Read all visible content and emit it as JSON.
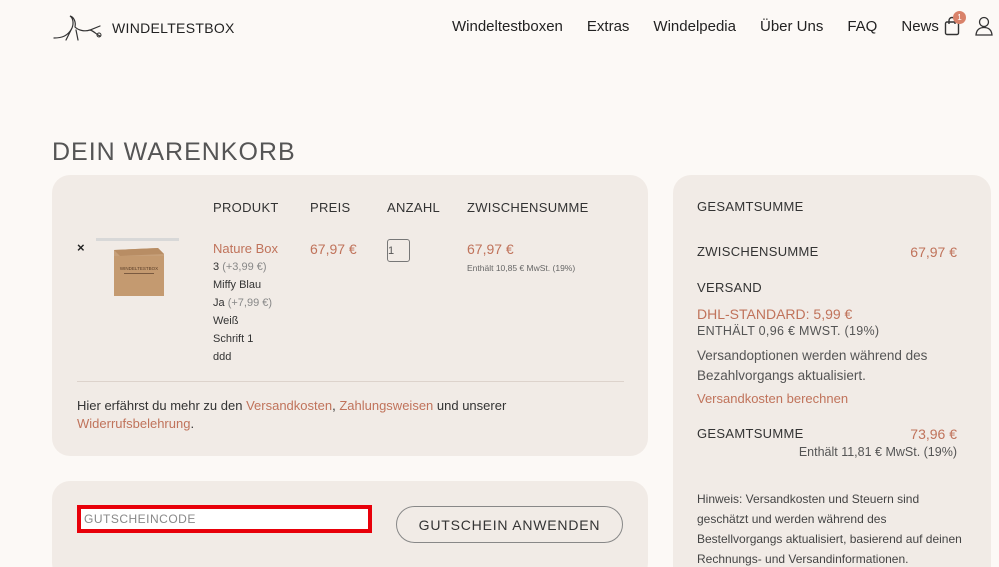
{
  "header": {
    "logo_text": "WINDELTESTBOX",
    "nav": [
      "Windeltestboxen",
      "Extras",
      "Windelpedia",
      "Über Uns",
      "FAQ",
      "News"
    ],
    "cart_count": "1"
  },
  "page_title": "DEIN WARENKORB",
  "cart": {
    "columns": {
      "product": "PRODUKT",
      "price": "PREIS",
      "quantity": "ANZAHL",
      "subtotal": "ZWISCHENSUMME"
    },
    "remove_label": "×",
    "item": {
      "image_text": "WINDELTESTBOX",
      "name": "Nature Box",
      "meta": [
        {
          "text": "3",
          "extra": "(+3,99 €)"
        },
        {
          "text": "Miffy Blau",
          "extra": ""
        },
        {
          "text": "Ja",
          "extra": "(+7,99 €)"
        },
        {
          "text": "Weiß",
          "extra": ""
        },
        {
          "text": "Schrift 1",
          "extra": ""
        },
        {
          "text": "ddd",
          "extra": ""
        }
      ],
      "price": "67,97 €",
      "quantity": "1",
      "subtotal": "67,97 €",
      "tax_note": "Enthält 10,85 € MwSt. (19%)"
    },
    "info": {
      "prefix": "Hier erfährst du mehr zu den ",
      "link1": "Versandkosten",
      "sep": ", ",
      "link2": "Zahlungsweisen",
      "mid": " und unserer ",
      "link3": "Widerrufsbelehrung",
      "suffix": "."
    }
  },
  "coupon": {
    "placeholder": "GUTSCHEINCODE",
    "button": "GUTSCHEIN ANWENDEN"
  },
  "totals": {
    "heading": "GESAMTSUMME",
    "subtotal_label": "ZWISCHENSUMME",
    "subtotal_value": "67,97 €",
    "shipping_label": "VERSAND",
    "shipping_rate": "DHL-STANDARD: 5,99 €",
    "shipping_tax": "ENTHÄLT 0,96 € MWST. (19%)",
    "shipping_note": "Versandoptionen werden während des Bezahlvorgangs aktualisiert.",
    "shipping_calc": "Versandkosten berechnen",
    "total_label": "GESAMTSUMME",
    "total_value": "73,96 €",
    "total_tax": "Enthält 11,81 € MwSt. (19%)",
    "hint": "Hinweis: Versandkosten und Steuern sind geschätzt und werden während des Bestellvorgangs aktualisiert, basierend auf deinen Rechnungs- und Versandinformationen."
  },
  "colors": {
    "accent": "#c0735b",
    "card_bg": "#f1ebe6",
    "page_bg": "#fcf9f6",
    "highlight": "#e8000a"
  }
}
